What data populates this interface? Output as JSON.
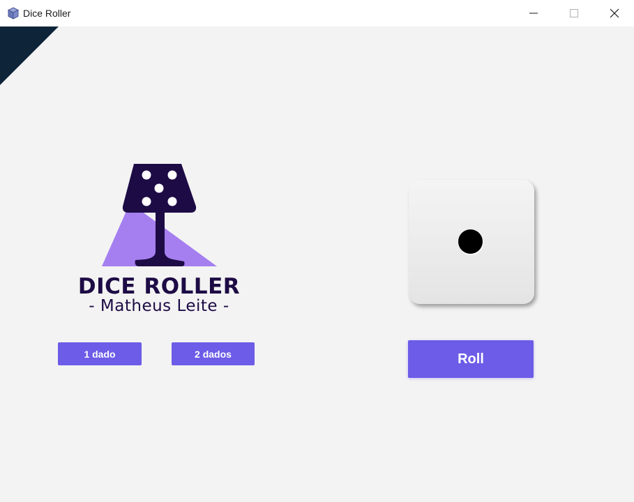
{
  "window": {
    "title": "Dice Roller",
    "controls": {
      "minimize": "minimize",
      "maximize": "maximize",
      "close": "close"
    }
  },
  "logo": {
    "title": "DICE ROLLER",
    "subtitle": "- Matheus Leite -",
    "colors": {
      "dark": "#1d0b45",
      "light": "#a57ff0"
    }
  },
  "buttons": {
    "one_die": "1 dado",
    "two_dice": "2 dados",
    "roll": "Roll"
  },
  "die": {
    "value": 1
  },
  "colors": {
    "accent": "#6c5ce7",
    "background": "#f3f3f3",
    "corner": "#0e2438"
  }
}
